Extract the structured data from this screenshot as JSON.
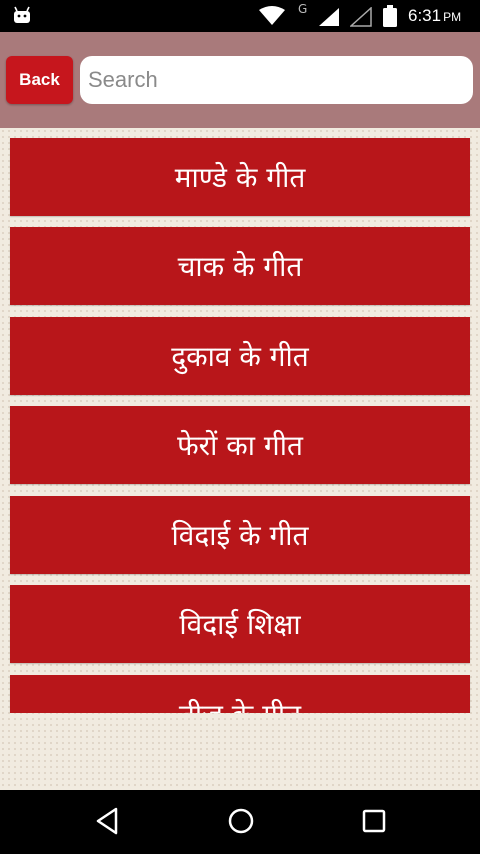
{
  "status_bar": {
    "network_label": "G",
    "time": "6:31",
    "ampm": "PM"
  },
  "header": {
    "back_label": "Back",
    "search_placeholder": "Search",
    "search_value": ""
  },
  "list": {
    "items": [
      {
        "label": "माण्डे के गीत"
      },
      {
        "label": "चाक के गीत"
      },
      {
        "label": "दुकाव के गीत"
      },
      {
        "label": "फेरों का गीत"
      },
      {
        "label": "विदाई के गीत"
      },
      {
        "label": "विदाई शिक्षा"
      },
      {
        "label": "तीज के गीत"
      }
    ]
  },
  "colors": {
    "header_bg": "#a97a7b",
    "item_bg": "#b8161a",
    "back_bg": "#c6161d"
  },
  "icons": {
    "status": [
      "android-icon",
      "wifi-icon",
      "signal-icon",
      "battery-icon"
    ],
    "nav": [
      "back-nav-icon",
      "home-nav-icon",
      "recents-nav-icon"
    ]
  }
}
